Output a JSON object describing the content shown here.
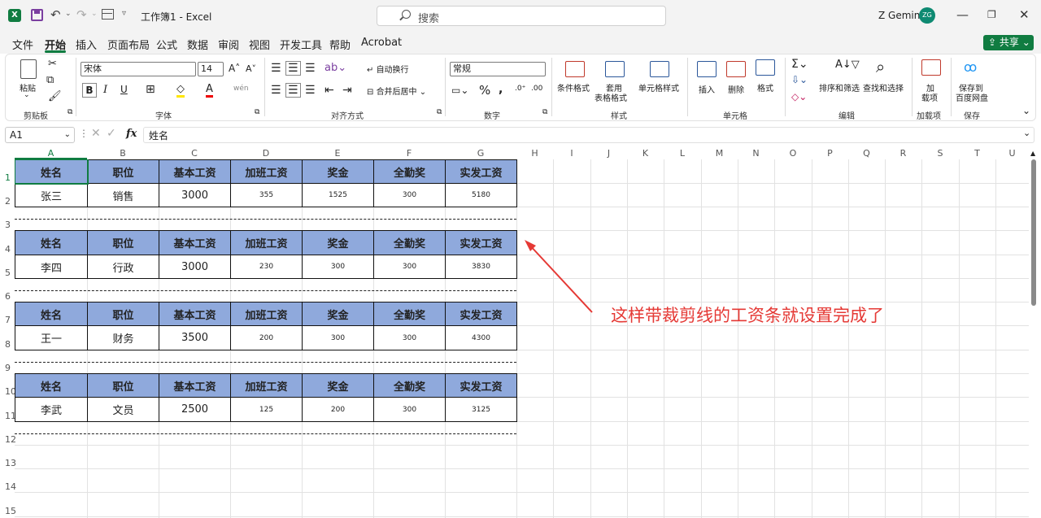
{
  "window": {
    "title": "工作簿1 - Excel",
    "app_icon": "excel-icon",
    "user": "Z Gemini",
    "avatar": "ZG"
  },
  "search": {
    "placeholder": "搜索"
  },
  "menus": [
    "文件",
    "开始",
    "插入",
    "页面布局",
    "公式",
    "数据",
    "审阅",
    "视图",
    "开发工具",
    "帮助",
    "Acrobat"
  ],
  "active_menu": "开始",
  "share": "共享",
  "ribbon": {
    "paste": "粘贴",
    "clipboard": "剪贴板",
    "font_name": "宋体",
    "font_size": "14",
    "font_group": "字体",
    "bold": "B",
    "italic": "I",
    "underline": "U",
    "wrap": "自动换行",
    "merge": "合并后居中",
    "align_group": "对齐方式",
    "number_format": "常规",
    "number_group": "数字",
    "percent": "%",
    "cond_format": "条件格式",
    "table_format_1": "套用",
    "table_format_2": "表格格式",
    "cell_style": "单元格样式",
    "style_group": "样式",
    "insert": "插入",
    "delete": "删除",
    "format": "格式",
    "cells_group": "单元格",
    "sort": "排序和筛选",
    "find": "查找和选择",
    "edit_group": "编辑",
    "addin_1": "加",
    "addin_2": "载项",
    "addin_group": "加载项",
    "save_1": "保存到",
    "save_2": "百度网盘",
    "save_group": "保存"
  },
  "formula_bar": {
    "cell": "A1",
    "fx": "fx",
    "value": "姓名"
  },
  "columns": [
    "A",
    "B",
    "C",
    "D",
    "E",
    "F",
    "G",
    "H",
    "I",
    "J",
    "K",
    "L",
    "M",
    "N",
    "O",
    "P",
    "Q",
    "R",
    "S",
    "T",
    "U"
  ],
  "rows": [
    "1",
    "2",
    "3",
    "4",
    "5",
    "6",
    "7",
    "8",
    "9",
    "10",
    "11",
    "12",
    "13",
    "14",
    "15"
  ],
  "headers": [
    "姓名",
    "职位",
    "基本工资",
    "加班工资",
    "奖金",
    "全勤奖",
    "实发工资"
  ],
  "records": [
    [
      "张三",
      "销售",
      "3000",
      "355",
      "1525",
      "300",
      "5180"
    ],
    [
      "李四",
      "行政",
      "3000",
      "230",
      "300",
      "300",
      "3830"
    ],
    [
      "王一",
      "财务",
      "3500",
      "200",
      "300",
      "300",
      "4300"
    ],
    [
      "李武",
      "文员",
      "2500",
      "125",
      "200",
      "300",
      "3125"
    ]
  ],
  "annotation": "这样带裁剪线的工资条就设置完成了",
  "colors": {
    "header_fill": "#8fa9dc",
    "accent": "#107c41",
    "annotation": "#e53935"
  }
}
